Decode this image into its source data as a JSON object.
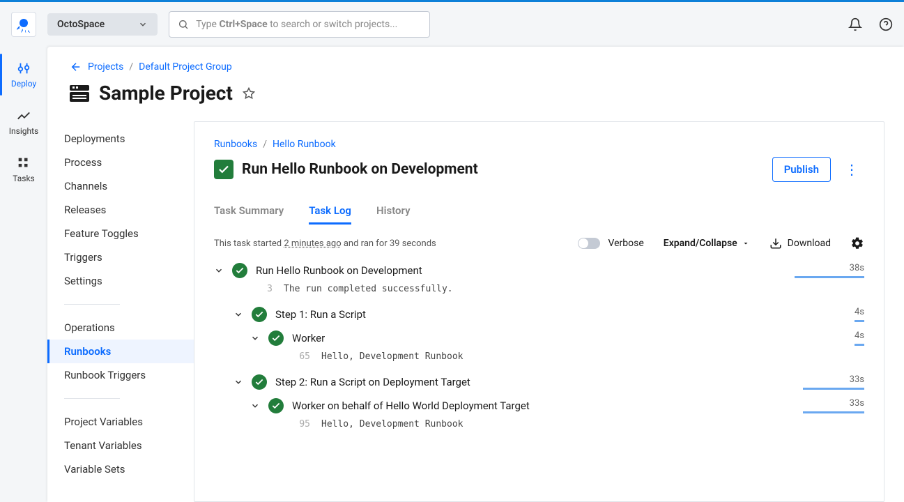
{
  "header": {
    "space": "OctoSpace",
    "search_placeholder_pre": "Type ",
    "search_placeholder_kbd": "Ctrl+Space",
    "search_placeholder_post": " to search or switch projects..."
  },
  "rail": {
    "deploy": "Deploy",
    "insights": "Insights",
    "tasks": "Tasks"
  },
  "breadcrumbs": {
    "projects": "Projects",
    "group": "Default Project Group"
  },
  "page_title": "Sample Project",
  "sidebar": {
    "items": [
      "Deployments",
      "Process",
      "Channels",
      "Releases",
      "Feature Toggles",
      "Triggers",
      "Settings"
    ],
    "group2": [
      "Operations",
      "Runbooks",
      "Runbook Triggers"
    ],
    "group3": [
      "Project Variables",
      "Tenant Variables",
      "Variable Sets"
    ]
  },
  "inner": {
    "crumbs": {
      "runbooks": "Runbooks",
      "hello": "Hello Runbook"
    },
    "title": "Run Hello Runbook on Development",
    "publish": "Publish"
  },
  "tabs": {
    "summary": "Task Summary",
    "log": "Task Log",
    "history": "History"
  },
  "tools": {
    "note_pre": "This task started ",
    "note_ts": "2 minutes ago",
    "note_post": " and ran for 39 seconds",
    "verbose": "Verbose",
    "expand": "Expand/Collapse",
    "download": "Download"
  },
  "log": {
    "root": {
      "title": "Run Hello Runbook on Development",
      "dur": "38s",
      "line": "3",
      "msg": "The run completed successfully."
    },
    "step1": {
      "title": "Step 1: Run a Script",
      "dur": "4s",
      "worker": {
        "title": "Worker",
        "dur": "4s",
        "line": "65",
        "msg": "Hello, Development Runbook"
      }
    },
    "step2": {
      "title": "Step 2: Run a Script on Deployment Target",
      "dur": "33s",
      "worker": {
        "title": "Worker on behalf of Hello World Deployment Target",
        "dur": "33s",
        "line": "95",
        "msg": "Hello, Development Runbook"
      }
    }
  }
}
